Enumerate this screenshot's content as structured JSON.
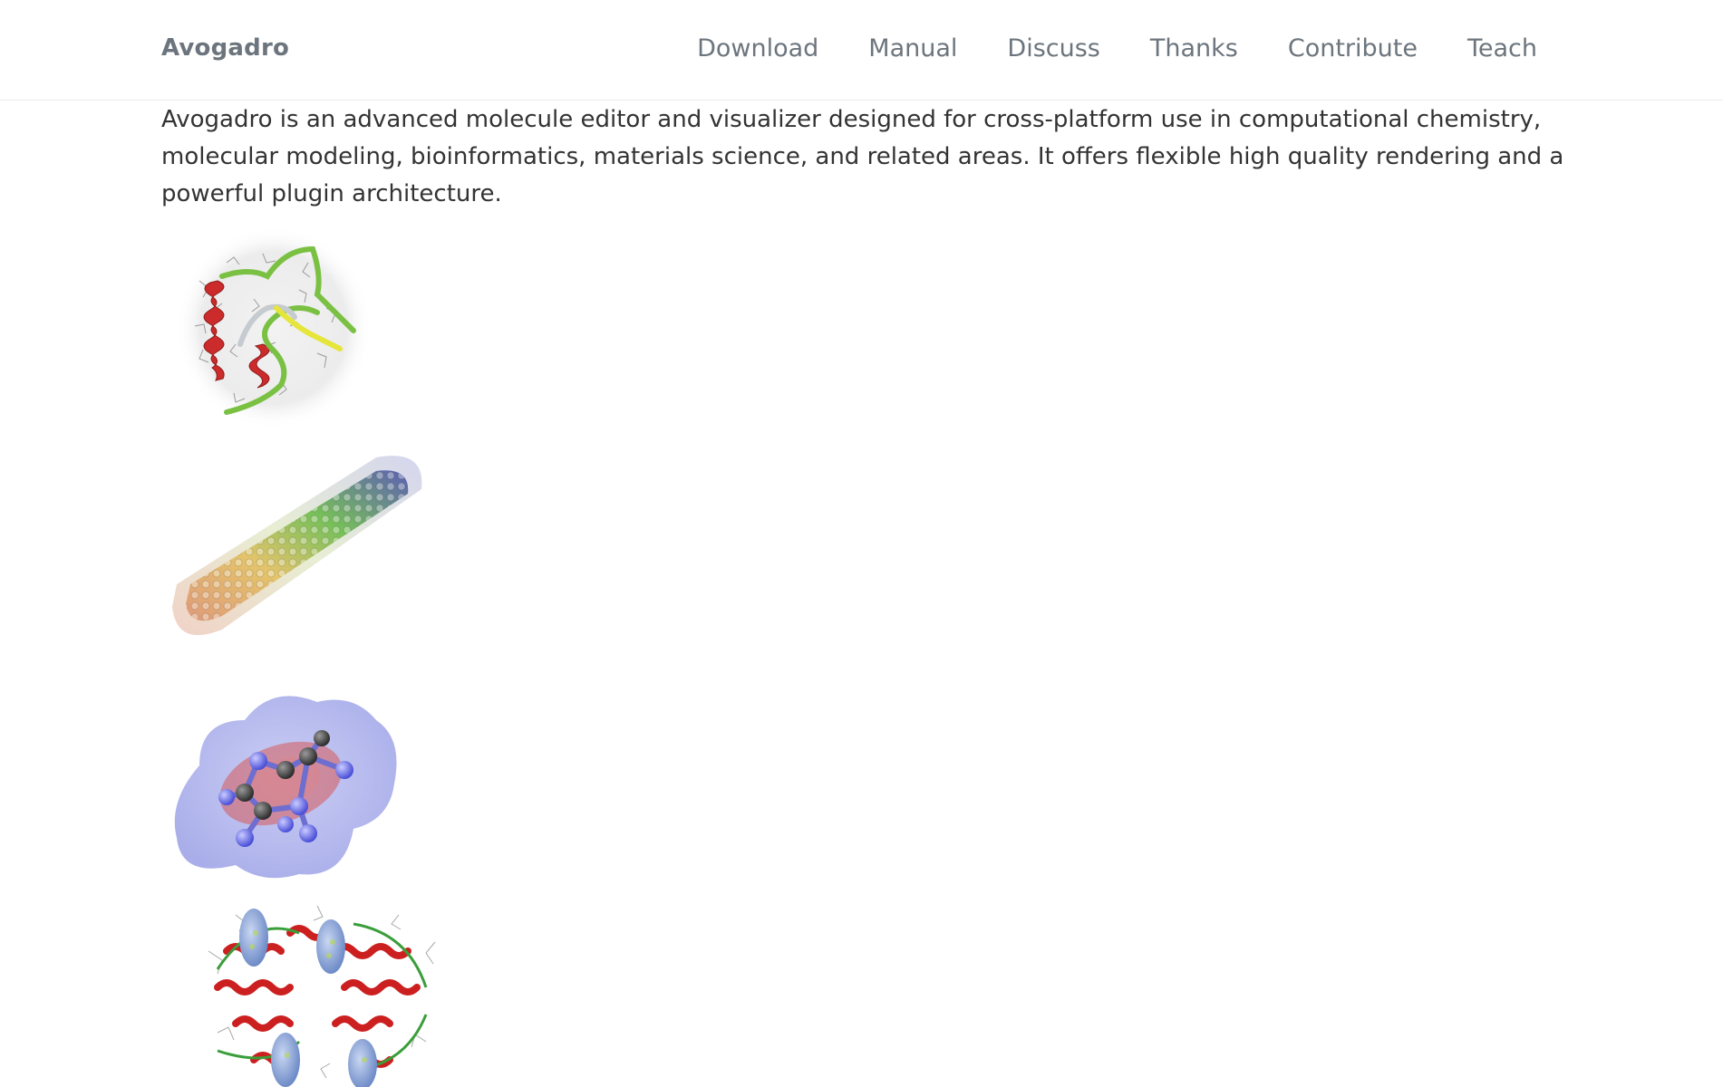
{
  "navbar": {
    "brand": "Avogadro",
    "links": [
      {
        "label": "Download"
      },
      {
        "label": "Manual"
      },
      {
        "label": "Discuss"
      },
      {
        "label": "Thanks"
      },
      {
        "label": "Contribute"
      },
      {
        "label": "Teach"
      }
    ]
  },
  "main": {
    "intro": "Avogadro is an advanced molecule editor and visualizer designed for cross-platform use in computational chemistry, molecular modeling, bioinformatics, materials science, and related areas. It offers flexible high quality rendering and a powerful plugin architecture."
  },
  "gallery": {
    "images": [
      {
        "name": "protein-ribbon-image"
      },
      {
        "name": "carbon-nanotube-image"
      },
      {
        "name": "molecular-surface-image"
      },
      {
        "name": "protein-complex-image"
      }
    ]
  },
  "colors": {
    "nav_text": "#6c757d",
    "body_text": "#333333",
    "helix_red": "#cc2b2b",
    "strand_green": "#7ac143",
    "surface_blue": "#9aa0e6"
  }
}
